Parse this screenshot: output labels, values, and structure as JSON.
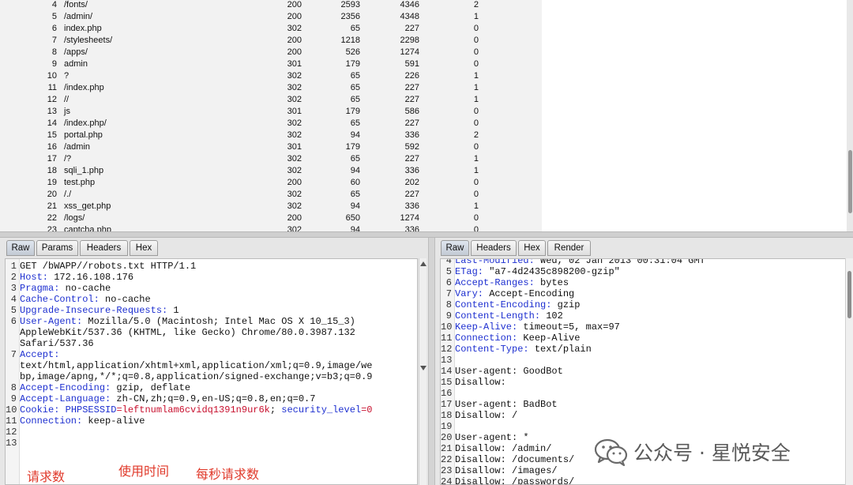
{
  "results": {
    "rows": [
      {
        "num": "4",
        "payload": "/fonts/",
        "status": "200",
        "length": "2593",
        "words": "4346",
        "lines": "2"
      },
      {
        "num": "5",
        "payload": "/admin/",
        "status": "200",
        "length": "2356",
        "words": "4348",
        "lines": "1"
      },
      {
        "num": "6",
        "payload": "index.php",
        "status": "302",
        "length": "65",
        "words": "227",
        "lines": "0"
      },
      {
        "num": "7",
        "payload": "/stylesheets/",
        "status": "200",
        "length": "1218",
        "words": "2298",
        "lines": "0"
      },
      {
        "num": "8",
        "payload": "/apps/",
        "status": "200",
        "length": "526",
        "words": "1274",
        "lines": "0"
      },
      {
        "num": "9",
        "payload": "admin",
        "status": "301",
        "length": "179",
        "words": "591",
        "lines": "0"
      },
      {
        "num": "10",
        "payload": "?",
        "status": "302",
        "length": "65",
        "words": "226",
        "lines": "1"
      },
      {
        "num": "11",
        "payload": "/index.php",
        "status": "302",
        "length": "65",
        "words": "227",
        "lines": "1"
      },
      {
        "num": "12",
        "payload": "//",
        "status": "302",
        "length": "65",
        "words": "227",
        "lines": "1"
      },
      {
        "num": "13",
        "payload": "js",
        "status": "301",
        "length": "179",
        "words": "586",
        "lines": "0"
      },
      {
        "num": "14",
        "payload": "/index.php/",
        "status": "302",
        "length": "65",
        "words": "227",
        "lines": "0"
      },
      {
        "num": "15",
        "payload": "portal.php",
        "status": "302",
        "length": "94",
        "words": "336",
        "lines": "2"
      },
      {
        "num": "16",
        "payload": "/admin",
        "status": "301",
        "length": "179",
        "words": "592",
        "lines": "0"
      },
      {
        "num": "17",
        "payload": "/?",
        "status": "302",
        "length": "65",
        "words": "227",
        "lines": "1"
      },
      {
        "num": "18",
        "payload": "sqli_1.php",
        "status": "302",
        "length": "94",
        "words": "336",
        "lines": "1"
      },
      {
        "num": "19",
        "payload": "test.php",
        "status": "200",
        "length": "60",
        "words": "202",
        "lines": "0"
      },
      {
        "num": "20",
        "payload": "/./",
        "status": "302",
        "length": "65",
        "words": "227",
        "lines": "0"
      },
      {
        "num": "21",
        "payload": "xss_get.php",
        "status": "302",
        "length": "94",
        "words": "336",
        "lines": "1"
      },
      {
        "num": "22",
        "payload": "/logs/",
        "status": "200",
        "length": "650",
        "words": "1274",
        "lines": "0"
      },
      {
        "num": "23",
        "payload": "captcha.php",
        "status": "302",
        "length": "94",
        "words": "336",
        "lines": "0"
      }
    ]
  },
  "request_pane": {
    "tabs": [
      "Raw",
      "Params",
      "Headers",
      "Hex"
    ],
    "active_tab": "Raw",
    "lines": [
      {
        "n": "1",
        "parts": [
          {
            "t": "GET /bWAPP//robots.txt HTTP/1.1",
            "c": ""
          }
        ]
      },
      {
        "n": "2",
        "parts": [
          {
            "t": "Host:",
            "c": "k"
          },
          {
            "t": " 172.16.108.176",
            "c": ""
          }
        ]
      },
      {
        "n": "3",
        "parts": [
          {
            "t": "Pragma:",
            "c": "k"
          },
          {
            "t": " no-cache",
            "c": ""
          }
        ]
      },
      {
        "n": "4",
        "parts": [
          {
            "t": "Cache-Control:",
            "c": "k"
          },
          {
            "t": " no-cache",
            "c": ""
          }
        ]
      },
      {
        "n": "5",
        "parts": [
          {
            "t": "Upgrade-Insecure-Requests:",
            "c": "k"
          },
          {
            "t": " 1",
            "c": ""
          }
        ]
      },
      {
        "n": "6",
        "parts": [
          {
            "t": "User-Agent:",
            "c": "k"
          },
          {
            "t": " Mozilla/5.0 (Macintosh; Intel Mac OS X 10_15_3)",
            "c": ""
          }
        ]
      },
      {
        "n": "",
        "parts": [
          {
            "t": "AppleWebKit/537.36 (KHTML, like Gecko) Chrome/80.0.3987.132",
            "c": ""
          }
        ]
      },
      {
        "n": "",
        "parts": [
          {
            "t": "Safari/537.36",
            "c": ""
          }
        ]
      },
      {
        "n": "7",
        "parts": [
          {
            "t": "Accept:",
            "c": "k"
          }
        ]
      },
      {
        "n": "",
        "parts": [
          {
            "t": "text/html,application/xhtml+xml,application/xml;q=0.9,image/we",
            "c": ""
          }
        ]
      },
      {
        "n": "",
        "parts": [
          {
            "t": "bp,image/apng,*/*;q=0.8,application/signed-exchange;v=b3;q=0.9",
            "c": ""
          }
        ]
      },
      {
        "n": "8",
        "parts": [
          {
            "t": "Accept-Encoding:",
            "c": "k"
          },
          {
            "t": " gzip, deflate",
            "c": ""
          }
        ]
      },
      {
        "n": "9",
        "parts": [
          {
            "t": "Accept-Language:",
            "c": "k"
          },
          {
            "t": " zh-CN,zh;q=0.9,en-US;q=0.8,en;q=0.7",
            "c": ""
          }
        ]
      },
      {
        "n": "10",
        "parts": [
          {
            "t": "Cookie:",
            "c": "k"
          },
          {
            "t": " ",
            "c": ""
          },
          {
            "t": "PHPSESSID",
            "c": "blue2"
          },
          {
            "t": "=leftnumlam6cvidq1391n9ur6k",
            "c": "red"
          },
          {
            "t": "; ",
            "c": ""
          },
          {
            "t": "security_level",
            "c": "blue2"
          },
          {
            "t": "=0",
            "c": "red"
          }
        ]
      },
      {
        "n": "11",
        "parts": [
          {
            "t": "Connection:",
            "c": "k"
          },
          {
            "t": " keep-alive",
            "c": ""
          }
        ]
      },
      {
        "n": "12",
        "parts": [
          {
            "t": "",
            "c": ""
          }
        ]
      },
      {
        "n": "13",
        "parts": [
          {
            "t": "",
            "c": ""
          }
        ]
      }
    ]
  },
  "response_pane": {
    "tabs": [
      "Raw",
      "Headers",
      "Hex",
      "Render"
    ],
    "active_tab": "Raw",
    "lines": [
      {
        "n": "4",
        "parts": [
          {
            "t": "Last-Modified:",
            "c": "k"
          },
          {
            "t": " Wed, 02 Jan 2013 00:31:04 GMT",
            "c": ""
          }
        ]
      },
      {
        "n": "5",
        "parts": [
          {
            "t": "ETag:",
            "c": "k"
          },
          {
            "t": " \"a7-4d2435c898200-gzip\"",
            "c": ""
          }
        ]
      },
      {
        "n": "6",
        "parts": [
          {
            "t": "Accept-Ranges:",
            "c": "k"
          },
          {
            "t": " bytes",
            "c": ""
          }
        ]
      },
      {
        "n": "7",
        "parts": [
          {
            "t": "Vary:",
            "c": "k"
          },
          {
            "t": " Accept-Encoding",
            "c": ""
          }
        ]
      },
      {
        "n": "8",
        "parts": [
          {
            "t": "Content-Encoding:",
            "c": "k"
          },
          {
            "t": " gzip",
            "c": ""
          }
        ]
      },
      {
        "n": "9",
        "parts": [
          {
            "t": "Content-Length:",
            "c": "k"
          },
          {
            "t": " 102",
            "c": ""
          }
        ]
      },
      {
        "n": "10",
        "parts": [
          {
            "t": "Keep-Alive:",
            "c": "k"
          },
          {
            "t": " timeout=5, max=97",
            "c": ""
          }
        ]
      },
      {
        "n": "11",
        "parts": [
          {
            "t": "Connection:",
            "c": "k"
          },
          {
            "t": " Keep-Alive",
            "c": ""
          }
        ]
      },
      {
        "n": "12",
        "parts": [
          {
            "t": "Content-Type:",
            "c": "k"
          },
          {
            "t": " text/plain",
            "c": ""
          }
        ]
      },
      {
        "n": "13",
        "parts": [
          {
            "t": "",
            "c": ""
          }
        ]
      },
      {
        "n": "14",
        "parts": [
          {
            "t": "User-agent: GoodBot",
            "c": ""
          }
        ]
      },
      {
        "n": "15",
        "parts": [
          {
            "t": "Disallow:",
            "c": ""
          }
        ]
      },
      {
        "n": "16",
        "parts": [
          {
            "t": "",
            "c": ""
          }
        ]
      },
      {
        "n": "17",
        "parts": [
          {
            "t": "User-agent: BadBot",
            "c": ""
          }
        ]
      },
      {
        "n": "18",
        "parts": [
          {
            "t": "Disallow: /",
            "c": ""
          }
        ]
      },
      {
        "n": "19",
        "parts": [
          {
            "t": "",
            "c": ""
          }
        ]
      },
      {
        "n": "20",
        "parts": [
          {
            "t": "User-agent: *",
            "c": ""
          }
        ]
      },
      {
        "n": "21",
        "parts": [
          {
            "t": "Disallow: /admin/",
            "c": ""
          }
        ]
      },
      {
        "n": "22",
        "parts": [
          {
            "t": "Disallow: /documents/",
            "c": ""
          }
        ]
      },
      {
        "n": "23",
        "parts": [
          {
            "t": "Disallow: /images/",
            "c": ""
          }
        ]
      },
      {
        "n": "24",
        "parts": [
          {
            "t": "Disallow: /passwords/",
            "c": ""
          }
        ]
      }
    ]
  },
  "annotations": {
    "requests": "请求数",
    "time_used": "使用时间",
    "per_second": "每秒请求数"
  },
  "watermark": {
    "icon": "wechat-icon",
    "text": "公众号 · 星悦安全"
  },
  "colors": {
    "header_key": "#1d2fd0",
    "cookie_value": "#c8102e",
    "annotation": "#e03a2b"
  }
}
